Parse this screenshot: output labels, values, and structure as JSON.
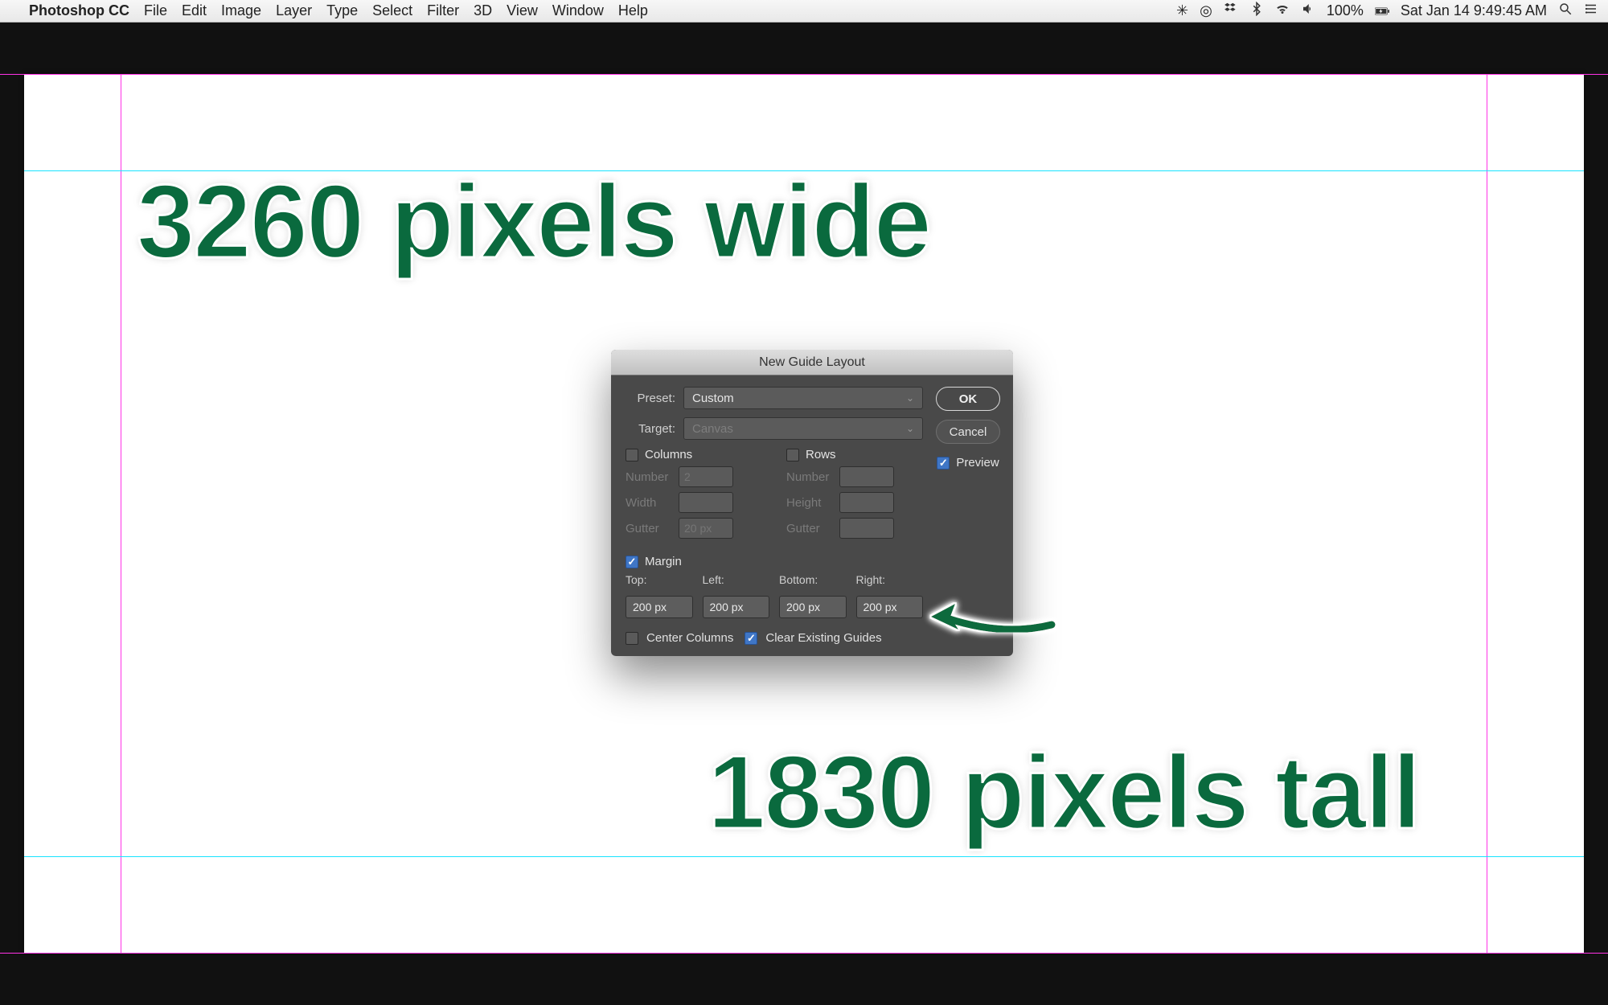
{
  "menubar": {
    "app": "Photoshop CC",
    "items": [
      "File",
      "Edit",
      "Image",
      "Layer",
      "Type",
      "Select",
      "Filter",
      "3D",
      "View",
      "Window",
      "Help"
    ],
    "battery_pct": "100%",
    "date_time": "Sat Jan 14  9:49:45 AM"
  },
  "annotations": {
    "wide": "3260 pixels wide",
    "tall": "1830 pixels tall"
  },
  "dialog": {
    "title": "New Guide Layout",
    "preset_label": "Preset:",
    "preset_value": "Custom",
    "target_label": "Target:",
    "target_value": "Canvas",
    "columns_label": "Columns",
    "rows_label": "Rows",
    "number_label": "Number",
    "width_label": "Width",
    "height_label": "Height",
    "gutter_label": "Gutter",
    "columns_number_placeholder": "2",
    "columns_gutter_placeholder": "20 px",
    "margin_label": "Margin",
    "margin": {
      "top_label": "Top:",
      "left_label": "Left:",
      "bottom_label": "Bottom:",
      "right_label": "Right:",
      "top": "200 px",
      "left": "200 px",
      "bottom": "200 px",
      "right": "200 px"
    },
    "center_columns_label": "Center Columns",
    "clear_guides_label": "Clear Existing Guides",
    "ok_label": "OK",
    "cancel_label": "Cancel",
    "preview_label": "Preview"
  }
}
